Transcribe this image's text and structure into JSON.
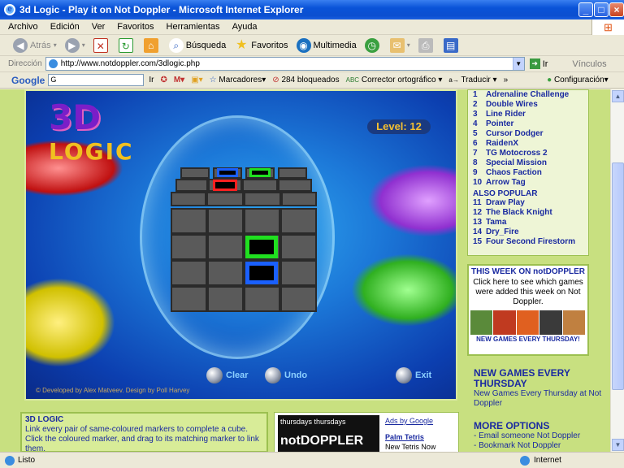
{
  "window": {
    "title": "3d Logic - Play it on Not Doppler - Microsoft Internet Explorer"
  },
  "menu": [
    "Archivo",
    "Edición",
    "Ver",
    "Favoritos",
    "Herramientas",
    "Ayuda"
  ],
  "toolbar": {
    "back": "Atrás",
    "search": "Búsqueda",
    "favorites": "Favoritos",
    "multimedia": "Multimedia"
  },
  "address": {
    "label": "Dirección",
    "url": "http://www.notdoppler.com/3dlogic.php",
    "go": "Ir",
    "links": "Vínculos"
  },
  "googlebar": {
    "logo": "Google",
    "search_value": "G",
    "go": "Ir",
    "bookmarks": "Marcadores",
    "blocked": "284 bloqueados",
    "spell": "Corrector ortográfico",
    "translate": "Traducir",
    "settings": "Configuración"
  },
  "game": {
    "logo_top": "3D",
    "logo_word": "LOGIC",
    "level_text": "Level: 12",
    "clear": "Clear",
    "undo": "Undo",
    "exit": "Exit",
    "credits": "© Developed by Alex Matveev. Design by Poll Harvey"
  },
  "top_list": [
    {
      "n": "1",
      "name": "Adrenaline Challenge"
    },
    {
      "n": "2",
      "name": "Double Wires"
    },
    {
      "n": "3",
      "name": "Line Rider"
    },
    {
      "n": "4",
      "name": "Pointer"
    },
    {
      "n": "5",
      "name": "Cursor Dodger"
    },
    {
      "n": "6",
      "name": "RaidenX"
    },
    {
      "n": "7",
      "name": "TG Motocross 2"
    },
    {
      "n": "8",
      "name": "Special Mission"
    },
    {
      "n": "9",
      "name": "Chaos Faction"
    },
    {
      "n": "10",
      "name": "Arrow Tag"
    }
  ],
  "also_popular_label": "ALSO POPULAR",
  "also_popular": [
    {
      "n": "11",
      "name": "Draw Play"
    },
    {
      "n": "12",
      "name": "The Black Knight"
    },
    {
      "n": "13",
      "name": "Tama"
    },
    {
      "n": "14",
      "name": "Dry_Fire"
    },
    {
      "n": "15",
      "name": "Four Second Firestorm"
    }
  ],
  "this_week": {
    "title": "THIS WEEK ON notDOPPLER",
    "text": "Click here to see which games were added this week on Not Doppler.",
    "footer": "NEW GAMES EVERY THURSDAY!"
  },
  "new_games": {
    "title": "NEW GAMES EVERY THURSDAY",
    "text": "New Games Every Thursday at Not Doppler"
  },
  "more_options": {
    "title": "MORE OPTIONS",
    "items": [
      "- Email someone Not Doppler",
      "- Bookmark Not Doppler"
    ]
  },
  "description": {
    "title": "3D LOGIC",
    "text": "Link every pair of same-coloured markers to complete a cube. Click the coloured marker, and drag to its matching marker to link them."
  },
  "ad": {
    "banner": "thursdays thursdays",
    "banner_brand": "notDOPPLER",
    "ads_by": "Ads by Google",
    "link": "Palm Tetris",
    "link_text": "New Tetris Now"
  },
  "status": {
    "left": "Listo",
    "zone": "Internet"
  },
  "colors": {
    "accent_green": "#a8d04e",
    "link_blue": "#1a2aa0",
    "titlebar": "#0a53d8"
  }
}
